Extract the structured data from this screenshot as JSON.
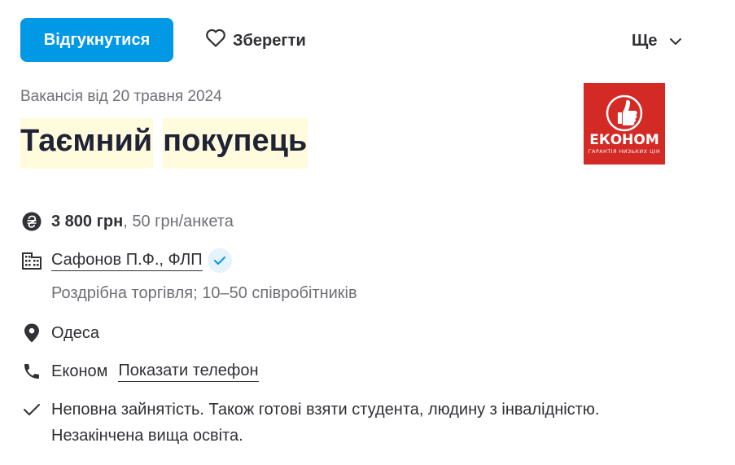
{
  "toolbar": {
    "respond_label": "Відгукнутися",
    "save_label": "Зберегти",
    "more_label": "Ще"
  },
  "vacancy": {
    "date_text": "Вакансія від 20 травня 2024",
    "title_words": [
      "Таємний",
      "покупець"
    ]
  },
  "company_logo": {
    "brand_text": "ЕКОНОМ",
    "slogan_text": "ГАРАНТІЯ НИЗЬКИХ ЦІН",
    "bg_color": "#d42a26"
  },
  "details": {
    "salary": {
      "amount": "3 800 грн",
      "extra": ", 50 грн/анкета"
    },
    "company": {
      "name": "Сафонов П.Ф., ФЛП",
      "meta": "Роздрібна торгівля; 10–50 співробітників"
    },
    "location": "Одеса",
    "contact": {
      "name": "Економ",
      "show_phone_label": "Показати телефон"
    },
    "employment": {
      "line1": "Неповна зайнятість. Також готові взяти студента, людину з інвалідністю.",
      "line2": "Незакінчена вища освіта."
    }
  },
  "colors": {
    "accent": "#0198e6",
    "title_highlight": "#fffbdc",
    "text": "#303035",
    "muted": "#6f6f77"
  }
}
